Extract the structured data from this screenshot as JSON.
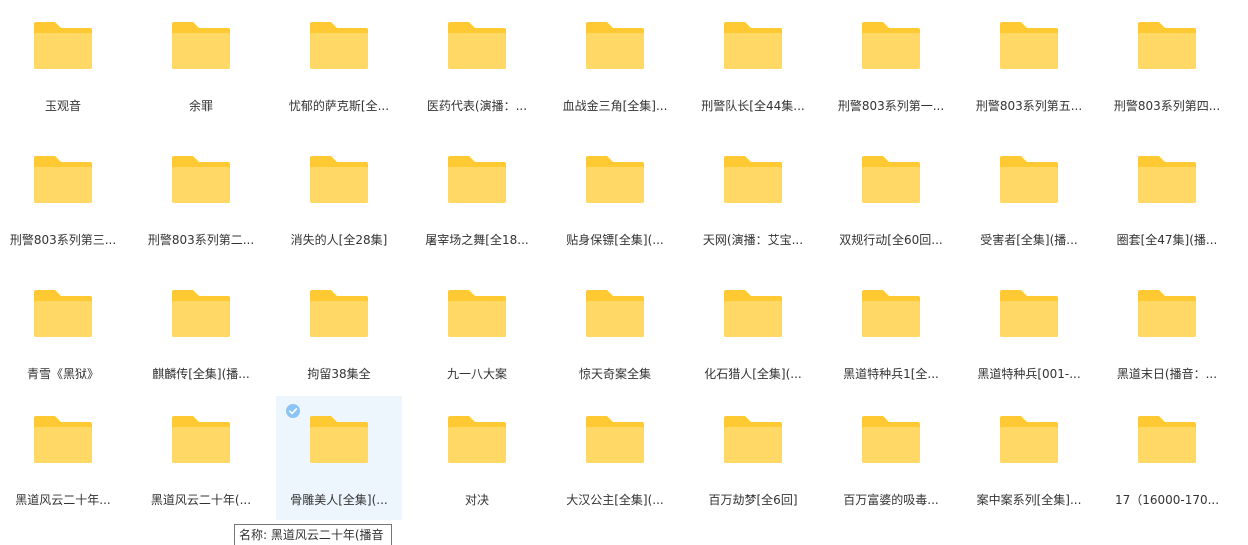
{
  "folders": [
    {
      "name": "玉观音",
      "selected": false
    },
    {
      "name": "余罪",
      "selected": false
    },
    {
      "name": "忧郁的萨克斯[全...",
      "selected": false
    },
    {
      "name": "医药代表(演播：...",
      "selected": false
    },
    {
      "name": "血战金三角[全集]...",
      "selected": false
    },
    {
      "name": "刑警队长[全44集...",
      "selected": false
    },
    {
      "name": "刑警803系列第一...",
      "selected": false
    },
    {
      "name": "刑警803系列第五...",
      "selected": false
    },
    {
      "name": "刑警803系列第四...",
      "selected": false
    },
    {
      "name": "刑警803系列第三...",
      "selected": false
    },
    {
      "name": "刑警803系列第二...",
      "selected": false
    },
    {
      "name": "消失的人[全28集]",
      "selected": false
    },
    {
      "name": "屠宰场之舞[全18...",
      "selected": false
    },
    {
      "name": "贴身保镖[全集](...",
      "selected": false
    },
    {
      "name": "天网(演播：艾宝...",
      "selected": false
    },
    {
      "name": "双规行动[全60回...",
      "selected": false
    },
    {
      "name": "受害者[全集](播...",
      "selected": false
    },
    {
      "name": "圈套[全47集](播...",
      "selected": false
    },
    {
      "name": "青雪《黑狱》",
      "selected": false
    },
    {
      "name": "麒麟传[全集](播...",
      "selected": false
    },
    {
      "name": "拘留38集全",
      "selected": false
    },
    {
      "name": "九一八大案",
      "selected": false
    },
    {
      "name": "惊天奇案全集",
      "selected": false
    },
    {
      "name": "化石猎人[全集](...",
      "selected": false
    },
    {
      "name": "黑道特种兵1[全...",
      "selected": false
    },
    {
      "name": "黑道特种兵[001-...",
      "selected": false
    },
    {
      "name": "黑道末日(播音：...",
      "selected": false
    },
    {
      "name": "黑道风云二十年...",
      "selected": false
    },
    {
      "name": "黑道风云二十年(...",
      "selected": false
    },
    {
      "name": "骨雕美人[全集](...",
      "selected": true
    },
    {
      "name": "对决",
      "selected": false
    },
    {
      "name": "大汉公主[全集](...",
      "selected": false
    },
    {
      "name": "百万劫梦[全6回]",
      "selected": false
    },
    {
      "name": "百万富婆的吸毒...",
      "selected": false
    },
    {
      "name": "案中案系列[全集]...",
      "selected": false
    },
    {
      "name": "17（16000-170...",
      "selected": false
    }
  ],
  "tooltip": {
    "text": "名称: 黑道风云二十年(播音"
  },
  "colors": {
    "folder_back": "#FFC933",
    "folder_front": "#FFD866",
    "selection_bg": "#EEF6FD",
    "check": "#8CC4F5"
  }
}
